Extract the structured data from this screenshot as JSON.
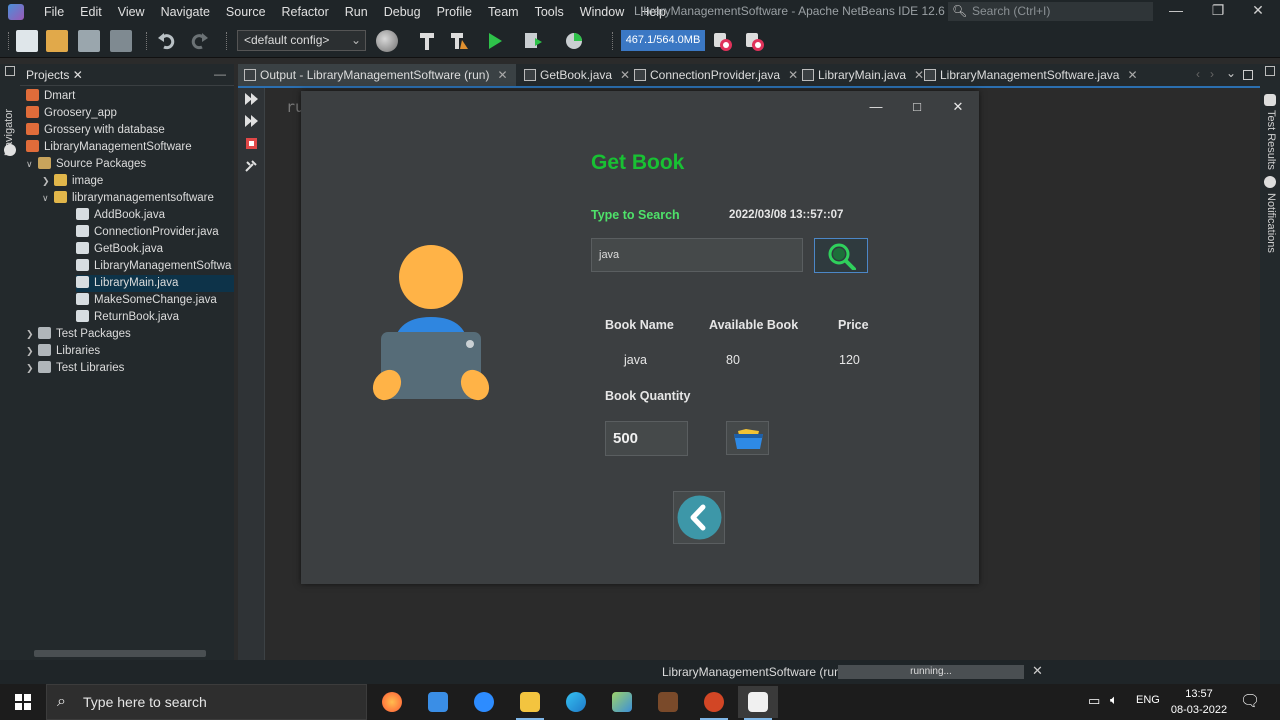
{
  "menubar": {
    "items": [
      "File",
      "Edit",
      "View",
      "Navigate",
      "Source",
      "Refactor",
      "Run",
      "Debug",
      "Profile",
      "Team",
      "Tools",
      "Window",
      "Help"
    ],
    "title": "LibraryManagementSoftware - Apache NetBeans IDE 12.6",
    "search_placeholder": "Search (Ctrl+I)"
  },
  "toolbar": {
    "config": "<default config>",
    "memory": "467.1/564.0MB"
  },
  "left_strip": {
    "label": "Navigator"
  },
  "projects": {
    "tab_label": "Projects",
    "rows": [
      {
        "label": "Dmart"
      },
      {
        "label": "Groosery_app"
      },
      {
        "label": "Grossery with database"
      },
      {
        "label": "LibraryManagementSoftware"
      },
      {
        "label": "Source Packages"
      },
      {
        "label": "image"
      },
      {
        "label": "librarymanagementsoftware"
      },
      {
        "label": "AddBook.java"
      },
      {
        "label": "ConnectionProvider.java"
      },
      {
        "label": "GetBook.java"
      },
      {
        "label": "LibraryManagementSoftwa"
      },
      {
        "label": "LibraryMain.java"
      },
      {
        "label": "MakeSomeChange.java"
      },
      {
        "label": "ReturnBook.java"
      },
      {
        "label": "Test Packages"
      },
      {
        "label": "Libraries"
      },
      {
        "label": "Test Libraries"
      }
    ]
  },
  "editor": {
    "tabs": [
      {
        "label": "Output - LibraryManagementSoftware (run)"
      },
      {
        "label": "GetBook.java"
      },
      {
        "label": "ConnectionProvider.java"
      },
      {
        "label": "LibraryMain.java"
      },
      {
        "label": "LibraryManagementSoftware.java"
      }
    ],
    "output_text": "ru"
  },
  "right_strip": {
    "test_results": "Test Results",
    "notifications": "Notifications"
  },
  "app": {
    "title": "Get Book",
    "search_label": "Type to Search",
    "timestamp": "2022/03/08 13::57::07",
    "search_value": "java",
    "columns": [
      "Book Name",
      "Available Book",
      "Price"
    ],
    "row": {
      "name": "java",
      "available": "80",
      "price": "120"
    },
    "quantity_label": "Book Quantity",
    "quantity_value": "500"
  },
  "statusbar": {
    "text": "LibraryManagementSoftware (run)",
    "progress_text": "running..."
  },
  "taskbar": {
    "search_placeholder": "Type here to search",
    "apps": [
      "firefox-icon",
      "store-icon",
      "zoom-icon",
      "file-explorer-icon",
      "edge-icon",
      "netbeans-app-icon",
      "game-icon",
      "powerpoint-icon",
      "java-icon"
    ],
    "lang": "ENG",
    "time": "13:57",
    "date": "08-03-2022"
  }
}
